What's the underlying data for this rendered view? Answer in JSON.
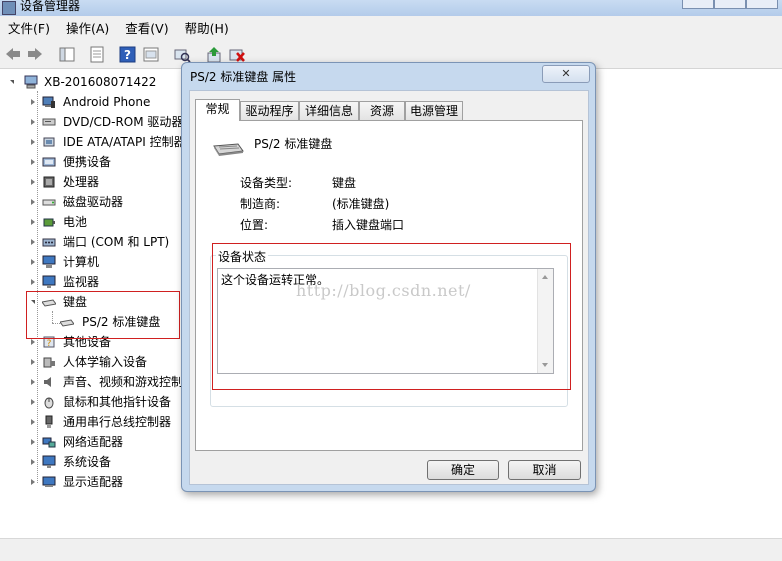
{
  "window": {
    "title": "设备管理器"
  },
  "menu": [
    "文件(F)",
    "操作(A)",
    "查看(V)",
    "帮助(H)"
  ],
  "tree": {
    "root": "XB-201608071422",
    "items": [
      {
        "label": "Android Phone",
        "icon": "phone-icon"
      },
      {
        "label": "DVD/CD-ROM 驱动器",
        "icon": "dvd-drive-icon"
      },
      {
        "label": "IDE ATA/ATAPI 控制器",
        "icon": "ide-controller-icon"
      },
      {
        "label": "便携设备",
        "icon": "portable-device-icon"
      },
      {
        "label": "处理器",
        "icon": "processor-icon"
      },
      {
        "label": "磁盘驱动器",
        "icon": "disk-drive-icon"
      },
      {
        "label": "电池",
        "icon": "battery-icon"
      },
      {
        "label": "端口 (COM 和 LPT)",
        "icon": "port-icon"
      },
      {
        "label": "计算机",
        "icon": "computer-icon"
      },
      {
        "label": "监视器",
        "icon": "monitor-icon"
      },
      {
        "label": "键盘",
        "icon": "keyboard-icon",
        "expanded": true
      },
      {
        "label": "PS/2 标准键盘",
        "icon": "keyboard-icon",
        "child": true
      },
      {
        "label": "其他设备",
        "icon": "unknown-device-icon"
      },
      {
        "label": "人体学输入设备",
        "icon": "hid-icon"
      },
      {
        "label": "声音、视频和游戏控制器",
        "icon": "sound-icon"
      },
      {
        "label": "鼠标和其他指针设备",
        "icon": "mouse-icon"
      },
      {
        "label": "通用串行总线控制器",
        "icon": "usb-icon"
      },
      {
        "label": "网络适配器",
        "icon": "network-adapter-icon"
      },
      {
        "label": "系统设备",
        "icon": "system-device-icon"
      },
      {
        "label": "显示适配器",
        "icon": "display-adapter-icon"
      }
    ]
  },
  "dialog": {
    "title": "PS/2 标准键盘 属性",
    "close": "✕",
    "tabs": [
      "常规",
      "驱动程序",
      "详细信息",
      "资源",
      "电源管理"
    ],
    "device_name": "PS/2 标准键盘",
    "props": [
      {
        "label": "设备类型:",
        "value": "键盘"
      },
      {
        "label": "制造商:",
        "value": "(标准键盘)"
      },
      {
        "label": "位置:",
        "value": "插入键盘端口"
      }
    ],
    "status_title": "设备状态",
    "status_text": "这个设备运转正常。",
    "ok": "确定",
    "cancel": "取消"
  },
  "watermark": "http://blog.csdn.net/",
  "colors": {
    "highlight_box": "#d02020",
    "dialog_frame": "#c6d9ee"
  }
}
